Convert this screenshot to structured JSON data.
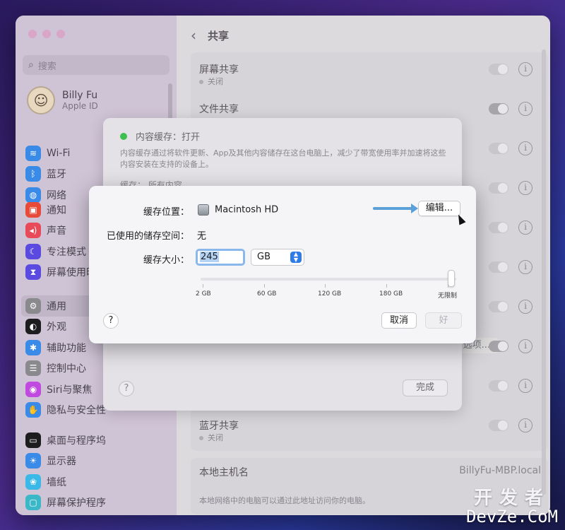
{
  "sidebar": {
    "search_placeholder": "搜索",
    "user": {
      "name": "Billy Fu",
      "sub": "Apple ID"
    },
    "groups": [
      [
        {
          "label": "Wi-Fi",
          "icon": "wifi-icon",
          "color": "#3a8ae8"
        },
        {
          "label": "蓝牙",
          "icon": "bluetooth-icon",
          "color": "#3a8ae8"
        },
        {
          "label": "网络",
          "icon": "network-icon",
          "color": "#3a8ae8"
        }
      ],
      [
        {
          "label": "通知",
          "icon": "notifications-icon",
          "color": "#e84a3a"
        },
        {
          "label": "声音",
          "icon": "sound-icon",
          "color": "#e84a5a"
        },
        {
          "label": "专注模式",
          "icon": "focus-icon",
          "color": "#5a4ae0"
        },
        {
          "label": "屏幕使用时间",
          "icon": "screen-time-icon",
          "color": "#5a4ae0"
        }
      ],
      [
        {
          "label": "通用",
          "icon": "general-icon",
          "color": "#8a8a8e",
          "active": true
        },
        {
          "label": "外观",
          "icon": "appearance-icon",
          "color": "#1d1d1f"
        },
        {
          "label": "辅助功能",
          "icon": "accessibility-icon",
          "color": "#3a8ae8"
        },
        {
          "label": "控制中心",
          "icon": "control-center-icon",
          "color": "#8a8a8e"
        },
        {
          "label": "Siri与聚焦",
          "icon": "siri-icon",
          "color": "#c04ae0"
        },
        {
          "label": "隐私与安全性",
          "icon": "privacy-hand-icon",
          "color": "#3a8ae8"
        }
      ],
      [
        {
          "label": "桌面与程序坞",
          "icon": "dock-icon",
          "color": "#1d1d1f"
        },
        {
          "label": "显示器",
          "icon": "display-icon",
          "color": "#3a8ae8"
        },
        {
          "label": "墙纸",
          "icon": "wallpaper-icon",
          "color": "#3ab8e8"
        },
        {
          "label": "屏幕保护程序",
          "icon": "screensaver-icon",
          "color": "#3ab8c8"
        }
      ]
    ]
  },
  "main": {
    "title": "共享",
    "rows": [
      {
        "title": "屏幕共享",
        "sub": "关闭",
        "toggle_on": false
      },
      {
        "title": "文件共享",
        "sub": "",
        "toggle_on": true
      }
    ],
    "bluetooth_row": {
      "title": "蓝牙共享",
      "sub": "关闭"
    },
    "options_label": "选项...",
    "hostname": {
      "label": "本地主机名",
      "value": "BillyFu-MBP.local",
      "hint": "本地网络中的电脑可以通过此地址访问你的电脑。"
    }
  },
  "content_caching_sheet": {
    "status": "内容缓存：打开",
    "description": "内容缓存通过将软件更新、App及其他内容储存在这台电脑上，减少了带宽使用率并加速将这些内容安装在支持的设备上。",
    "cache_line": "缓存：   所有内容",
    "help": "?",
    "done": "完成"
  },
  "dialog": {
    "location_label": "缓存位置：",
    "location_value": "Macintosh HD",
    "edit_button": "编辑...",
    "used_label": "已使用的储存空间：",
    "used_value": "无",
    "size_label": "缓存大小：",
    "size_value": "245",
    "unit": "GB",
    "slider_labels": [
      "2 GB",
      "60 GB",
      "120 GB",
      "180 GB",
      "无限制"
    ],
    "slider_value": "无限制",
    "help": "?",
    "cancel": "取消",
    "ok": "好"
  },
  "watermark": {
    "top": "开发者",
    "bottom": "DevZe.CoM"
  },
  "colors": {
    "accent": "#2f7ce8",
    "status_green": "#3ec050",
    "arrow": "#5ba0d8"
  }
}
